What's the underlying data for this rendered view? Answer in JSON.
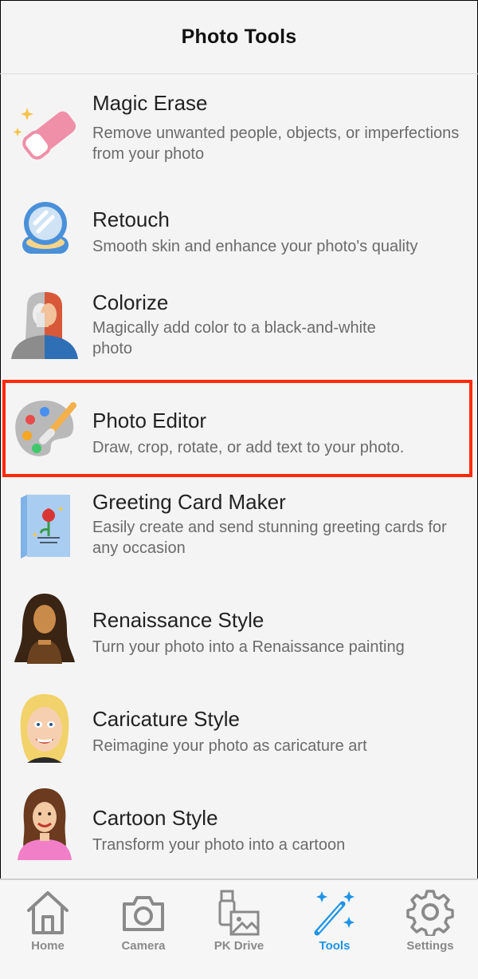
{
  "header": {
    "title": "Photo Tools"
  },
  "tools": [
    {
      "name": "Magic Erase",
      "desc": "Remove unwanted people, objects, or imperfections from your photo",
      "icon": "eraser-icon"
    },
    {
      "name": "Retouch",
      "desc": "Smooth skin and enhance your photo's quality",
      "icon": "compact-mirror-icon"
    },
    {
      "name": "Colorize",
      "desc": "Magically add color to a black-and-white photo",
      "icon": "colorize-portrait-icon"
    },
    {
      "name": "Photo Editor",
      "desc": "Draw, crop, rotate, or add text to your photo.",
      "icon": "palette-icon"
    },
    {
      "name": "Greeting Card Maker",
      "desc": "Easily create and send stunning greeting cards for any occasion",
      "icon": "greeting-card-icon"
    },
    {
      "name": "Renaissance Style",
      "desc": "Turn your photo into a Renaissance painting",
      "icon": "renaissance-portrait-icon"
    },
    {
      "name": "Caricature Style",
      "desc": "Reimagine your photo as caricature art",
      "icon": "caricature-face-icon"
    },
    {
      "name": "Cartoon Style",
      "desc": "Transform your photo into a cartoon",
      "icon": "cartoon-woman-icon"
    }
  ],
  "tabbar": {
    "items": [
      {
        "label": "Home",
        "icon": "home-icon"
      },
      {
        "label": "Camera",
        "icon": "camera-icon"
      },
      {
        "label": "PK Drive",
        "icon": "drive-icon"
      },
      {
        "label": "Tools",
        "icon": "magic-wand-icon"
      },
      {
        "label": "Settings",
        "icon": "gear-icon"
      }
    ],
    "active": "Tools"
  },
  "colors": {
    "accent": "#1f93e6",
    "highlight": "#ff2a0a",
    "inactive": "#8a8a8a"
  }
}
